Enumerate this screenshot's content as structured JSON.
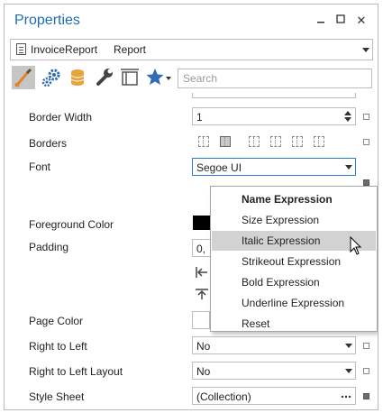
{
  "window": {
    "title": "Properties",
    "controls": {
      "close": "✕"
    }
  },
  "object_selector": {
    "name": "InvoiceReport",
    "type": "Report"
  },
  "toolbar": {
    "icons": [
      "brush-icon",
      "gears-icon",
      "database-icon",
      "wrench-icon",
      "layout-icon",
      "star-icon"
    ],
    "search_placeholder": "Search"
  },
  "properties": [
    {
      "label": "Border Width",
      "value": "1",
      "editor": "spin"
    },
    {
      "label": "Borders",
      "editor": "borders"
    },
    {
      "label": "Font",
      "value": "Segoe UI",
      "editor": "dropdown"
    },
    {
      "label": "Foreground Color",
      "editor": "color",
      "color": "#000000"
    },
    {
      "label": "Padding",
      "value": "0,",
      "editor": "text"
    },
    {
      "label": "Page Color",
      "editor": "color",
      "color": "#ffffff"
    },
    {
      "label": "Right to Left",
      "value": "No",
      "editor": "dropdown"
    },
    {
      "label": "Right to Left Layout",
      "value": "No",
      "editor": "dropdown"
    },
    {
      "label": "Style Sheet",
      "value": "(Collection)",
      "editor": "ellipsis"
    }
  ],
  "context_menu": {
    "items": [
      {
        "label": "Name Expression",
        "bold": true
      },
      {
        "label": "Size Expression"
      },
      {
        "label": "Italic Expression",
        "highlighted": true
      },
      {
        "label": "Strikeout Expression"
      },
      {
        "label": "Bold Expression"
      },
      {
        "label": "Underline Expression"
      },
      {
        "label": "Reset"
      }
    ]
  },
  "colors": {
    "title_blue": "#1e6bb8",
    "accent_focus": "#2a7cd0",
    "menu_highlight": "#d2d2d2",
    "brush_orange": "#e0832b",
    "database_orange": "#e8a33d",
    "gear_blue": "#2f6db5"
  }
}
